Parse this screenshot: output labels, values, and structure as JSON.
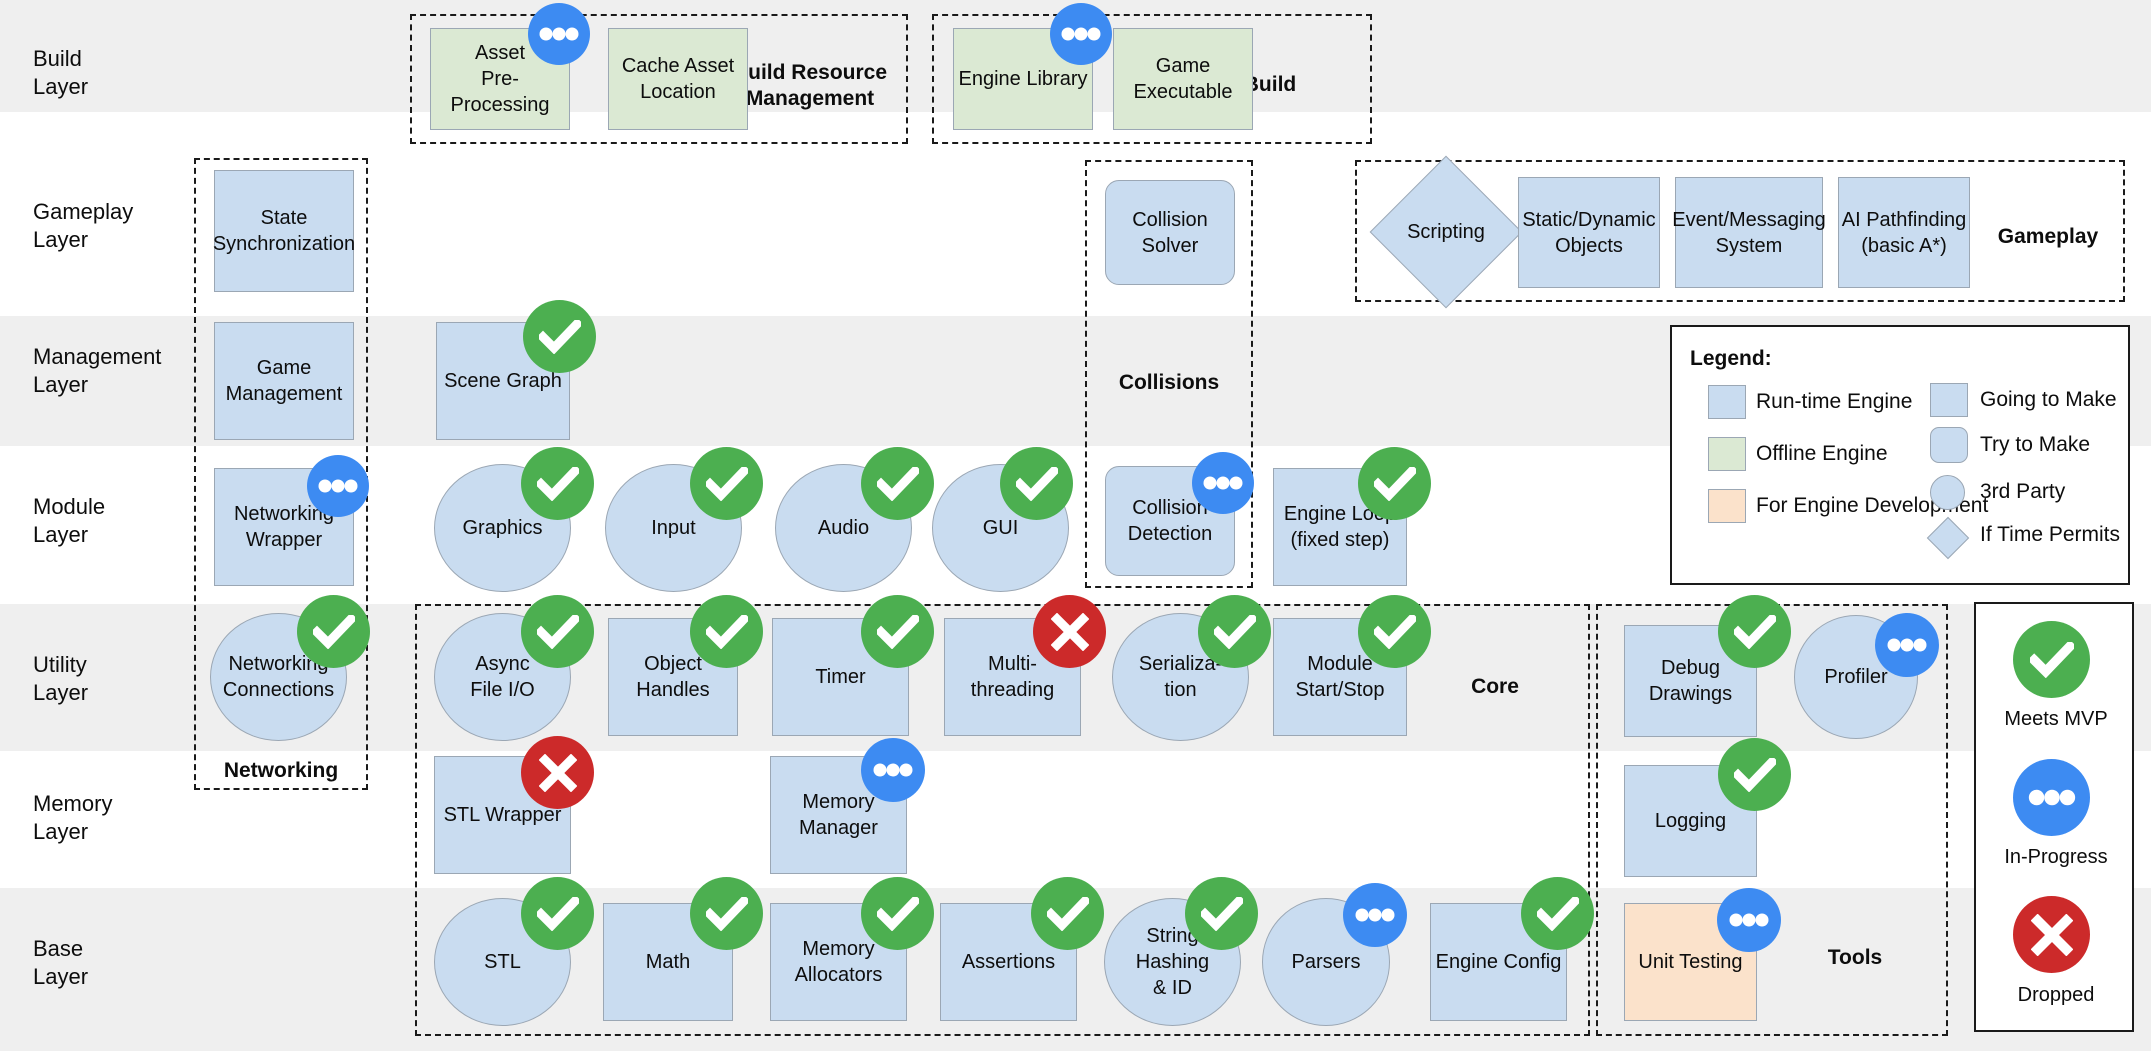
{
  "rows": [
    {
      "label": "Build\nLayer",
      "shaded": true
    },
    {
      "label": "Gameplay\nLayer",
      "shaded": false
    },
    {
      "label": "Management\nLayer",
      "shaded": true
    },
    {
      "label": "Module\nLayer",
      "shaded": false
    },
    {
      "label": "Utility\nLayer",
      "shaded": true
    },
    {
      "label": "Memory\nLayer",
      "shaded": false
    },
    {
      "label": "Base\nLayer",
      "shaded": true
    }
  ],
  "group_labels": {
    "build_resource_management": "Build Resource\nManagement",
    "build": "Build",
    "gameplay": "Gameplay",
    "collisions": "Collisions",
    "networking": "Networking",
    "core": "Core",
    "tools": "Tools"
  },
  "nodes": {
    "asset_pre_processing": "Asset\nPre-Processing",
    "cache_asset_location": "Cache Asset\nLocation",
    "engine_library": "Engine Library",
    "game_executable": "Game\nExecutable",
    "state_synchronization": "State\nSynchronization",
    "collision_solver": "Collision\nSolver",
    "scripting": "Scripting",
    "static_dynamic_objects": "Static/Dynamic\nObjects",
    "event_messaging_system": "Event/Messaging\nSystem",
    "ai_pathfinding": "AI Pathfinding\n(basic A*)",
    "game_management": "Game\nManagement",
    "scene_graph": "Scene Graph",
    "networking_wrapper": "Networking\nWrapper",
    "graphics": "Graphics",
    "input": "Input",
    "audio": "Audio",
    "gui": "GUI",
    "collision_detection": "Collision\nDetection",
    "engine_loop": "Engine Loop\n(fixed step)",
    "networking_connections": "Networking\nConnections",
    "async_file_io": "Async\nFile I/O",
    "object_handles": "Object\nHandles",
    "timer": "Timer",
    "multi_threading": "Multi-\nthreading",
    "serialization": "Serializa-\ntion",
    "module_start_stop": "Module\nStart/Stop",
    "debug_drawings": "Debug\nDrawings",
    "profiler": "Profiler",
    "stl_wrapper": "STL Wrapper",
    "memory_manager": "Memory\nManager",
    "logging": "Logging",
    "stl": "STL",
    "math": "Math",
    "memory_allocators": "Memory\nAllocators",
    "assertions": "Assertions",
    "string_hashing_id": "String\nHashing\n& ID",
    "parsers": "Parsers",
    "engine_config": "Engine Config",
    "unit_testing": "Unit Testing"
  },
  "legend": {
    "title": "Legend:",
    "left_items": [
      {
        "label": "Run-time Engine",
        "color": "#c9dcf0",
        "shape": "square"
      },
      {
        "label": "Offline Engine",
        "color": "#dbe9d3",
        "shape": "square"
      },
      {
        "label": "For Engine Development",
        "color": "#fbe2cb",
        "shape": "square"
      }
    ],
    "right_items": [
      {
        "label": "Going to Make",
        "color": "#c9dcf0",
        "shape": "square"
      },
      {
        "label": "Try to Make",
        "color": "#c9dcf0",
        "shape": "rounded"
      },
      {
        "label": "3rd Party",
        "color": "#c9dcf0",
        "shape": "circle"
      },
      {
        "label": "If Time Permits",
        "color": "#c9dcf0",
        "shape": "diamond"
      }
    ]
  },
  "status_legend": {
    "items": [
      {
        "label": "Meets MVP",
        "icon": "check-icon",
        "color": "#4caf50"
      },
      {
        "label": "In-Progress",
        "icon": "ellipsis-icon",
        "color": "#3d8bf2"
      },
      {
        "label": "Dropped",
        "icon": "cross-icon",
        "color": "#cc2a2a"
      }
    ]
  },
  "colors": {
    "runtime_engine": "#c9dcf0",
    "offline_engine": "#dbe9d3",
    "engine_development": "#fbe2cb",
    "meets_mvp": "#4caf50",
    "in_progress": "#3d8bf2",
    "dropped": "#cc2a2a",
    "band": "#efefef"
  }
}
